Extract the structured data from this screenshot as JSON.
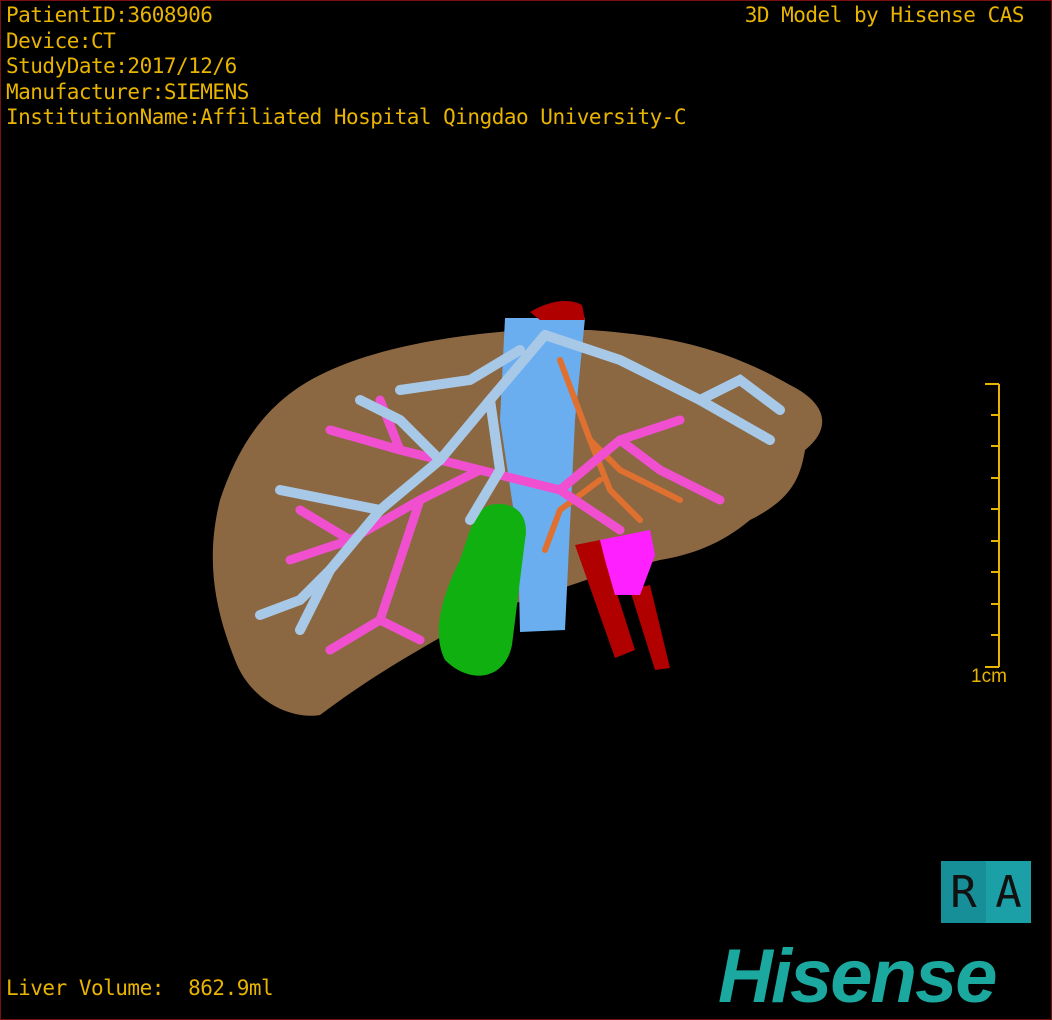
{
  "info": {
    "patient_id": "PatientID:3608906",
    "device": "Device:CT",
    "study_date": "StudyDate:2017/12/6",
    "manufacturer": "Manufacturer:SIEMENS",
    "institution": "InstitutionName:Affiliated Hospital Qingdao University-C"
  },
  "credit": "3D Model by Hisense CAS",
  "liver_volume": "Liver Volume:  862.9ml",
  "scale_bar": {
    "label": "1cm",
    "color": "#e8b400"
  },
  "orientation": {
    "left": "R",
    "right": "A"
  },
  "logo": "Hisense",
  "colors": {
    "text": "#e8b400",
    "liver": "#a57a4e",
    "hepatic_vein": "#a8c8e8",
    "portal_vein": "#f050d0",
    "artery": "#b00000",
    "biliary": "#e07030",
    "gallbladder": "#10b010",
    "ivc": "#6aaef0",
    "brand": "#1ba99f"
  }
}
